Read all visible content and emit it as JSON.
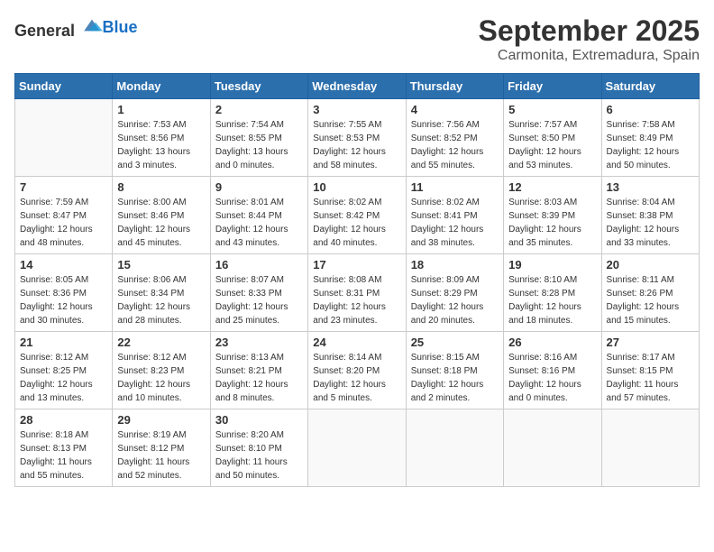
{
  "logo": {
    "general": "General",
    "blue": "Blue"
  },
  "title": "September 2025",
  "subtitle": "Carmonita, Extremadura, Spain",
  "weekdays": [
    "Sunday",
    "Monday",
    "Tuesday",
    "Wednesday",
    "Thursday",
    "Friday",
    "Saturday"
  ],
  "weeks": [
    [
      {
        "day": "",
        "sunrise": "",
        "sunset": "",
        "daylight": ""
      },
      {
        "day": "1",
        "sunrise": "Sunrise: 7:53 AM",
        "sunset": "Sunset: 8:56 PM",
        "daylight": "Daylight: 13 hours and 3 minutes."
      },
      {
        "day": "2",
        "sunrise": "Sunrise: 7:54 AM",
        "sunset": "Sunset: 8:55 PM",
        "daylight": "Daylight: 13 hours and 0 minutes."
      },
      {
        "day": "3",
        "sunrise": "Sunrise: 7:55 AM",
        "sunset": "Sunset: 8:53 PM",
        "daylight": "Daylight: 12 hours and 58 minutes."
      },
      {
        "day": "4",
        "sunrise": "Sunrise: 7:56 AM",
        "sunset": "Sunset: 8:52 PM",
        "daylight": "Daylight: 12 hours and 55 minutes."
      },
      {
        "day": "5",
        "sunrise": "Sunrise: 7:57 AM",
        "sunset": "Sunset: 8:50 PM",
        "daylight": "Daylight: 12 hours and 53 minutes."
      },
      {
        "day": "6",
        "sunrise": "Sunrise: 7:58 AM",
        "sunset": "Sunset: 8:49 PM",
        "daylight": "Daylight: 12 hours and 50 minutes."
      }
    ],
    [
      {
        "day": "7",
        "sunrise": "Sunrise: 7:59 AM",
        "sunset": "Sunset: 8:47 PM",
        "daylight": "Daylight: 12 hours and 48 minutes."
      },
      {
        "day": "8",
        "sunrise": "Sunrise: 8:00 AM",
        "sunset": "Sunset: 8:46 PM",
        "daylight": "Daylight: 12 hours and 45 minutes."
      },
      {
        "day": "9",
        "sunrise": "Sunrise: 8:01 AM",
        "sunset": "Sunset: 8:44 PM",
        "daylight": "Daylight: 12 hours and 43 minutes."
      },
      {
        "day": "10",
        "sunrise": "Sunrise: 8:02 AM",
        "sunset": "Sunset: 8:42 PM",
        "daylight": "Daylight: 12 hours and 40 minutes."
      },
      {
        "day": "11",
        "sunrise": "Sunrise: 8:02 AM",
        "sunset": "Sunset: 8:41 PM",
        "daylight": "Daylight: 12 hours and 38 minutes."
      },
      {
        "day": "12",
        "sunrise": "Sunrise: 8:03 AM",
        "sunset": "Sunset: 8:39 PM",
        "daylight": "Daylight: 12 hours and 35 minutes."
      },
      {
        "day": "13",
        "sunrise": "Sunrise: 8:04 AM",
        "sunset": "Sunset: 8:38 PM",
        "daylight": "Daylight: 12 hours and 33 minutes."
      }
    ],
    [
      {
        "day": "14",
        "sunrise": "Sunrise: 8:05 AM",
        "sunset": "Sunset: 8:36 PM",
        "daylight": "Daylight: 12 hours and 30 minutes."
      },
      {
        "day": "15",
        "sunrise": "Sunrise: 8:06 AM",
        "sunset": "Sunset: 8:34 PM",
        "daylight": "Daylight: 12 hours and 28 minutes."
      },
      {
        "day": "16",
        "sunrise": "Sunrise: 8:07 AM",
        "sunset": "Sunset: 8:33 PM",
        "daylight": "Daylight: 12 hours and 25 minutes."
      },
      {
        "day": "17",
        "sunrise": "Sunrise: 8:08 AM",
        "sunset": "Sunset: 8:31 PM",
        "daylight": "Daylight: 12 hours and 23 minutes."
      },
      {
        "day": "18",
        "sunrise": "Sunrise: 8:09 AM",
        "sunset": "Sunset: 8:29 PM",
        "daylight": "Daylight: 12 hours and 20 minutes."
      },
      {
        "day": "19",
        "sunrise": "Sunrise: 8:10 AM",
        "sunset": "Sunset: 8:28 PM",
        "daylight": "Daylight: 12 hours and 18 minutes."
      },
      {
        "day": "20",
        "sunrise": "Sunrise: 8:11 AM",
        "sunset": "Sunset: 8:26 PM",
        "daylight": "Daylight: 12 hours and 15 minutes."
      }
    ],
    [
      {
        "day": "21",
        "sunrise": "Sunrise: 8:12 AM",
        "sunset": "Sunset: 8:25 PM",
        "daylight": "Daylight: 12 hours and 13 minutes."
      },
      {
        "day": "22",
        "sunrise": "Sunrise: 8:12 AM",
        "sunset": "Sunset: 8:23 PM",
        "daylight": "Daylight: 12 hours and 10 minutes."
      },
      {
        "day": "23",
        "sunrise": "Sunrise: 8:13 AM",
        "sunset": "Sunset: 8:21 PM",
        "daylight": "Daylight: 12 hours and 8 minutes."
      },
      {
        "day": "24",
        "sunrise": "Sunrise: 8:14 AM",
        "sunset": "Sunset: 8:20 PM",
        "daylight": "Daylight: 12 hours and 5 minutes."
      },
      {
        "day": "25",
        "sunrise": "Sunrise: 8:15 AM",
        "sunset": "Sunset: 8:18 PM",
        "daylight": "Daylight: 12 hours and 2 minutes."
      },
      {
        "day": "26",
        "sunrise": "Sunrise: 8:16 AM",
        "sunset": "Sunset: 8:16 PM",
        "daylight": "Daylight: 12 hours and 0 minutes."
      },
      {
        "day": "27",
        "sunrise": "Sunrise: 8:17 AM",
        "sunset": "Sunset: 8:15 PM",
        "daylight": "Daylight: 11 hours and 57 minutes."
      }
    ],
    [
      {
        "day": "28",
        "sunrise": "Sunrise: 8:18 AM",
        "sunset": "Sunset: 8:13 PM",
        "daylight": "Daylight: 11 hours and 55 minutes."
      },
      {
        "day": "29",
        "sunrise": "Sunrise: 8:19 AM",
        "sunset": "Sunset: 8:12 PM",
        "daylight": "Daylight: 11 hours and 52 minutes."
      },
      {
        "day": "30",
        "sunrise": "Sunrise: 8:20 AM",
        "sunset": "Sunset: 8:10 PM",
        "daylight": "Daylight: 11 hours and 50 minutes."
      },
      {
        "day": "",
        "sunrise": "",
        "sunset": "",
        "daylight": ""
      },
      {
        "day": "",
        "sunrise": "",
        "sunset": "",
        "daylight": ""
      },
      {
        "day": "",
        "sunrise": "",
        "sunset": "",
        "daylight": ""
      },
      {
        "day": "",
        "sunrise": "",
        "sunset": "",
        "daylight": ""
      }
    ]
  ]
}
